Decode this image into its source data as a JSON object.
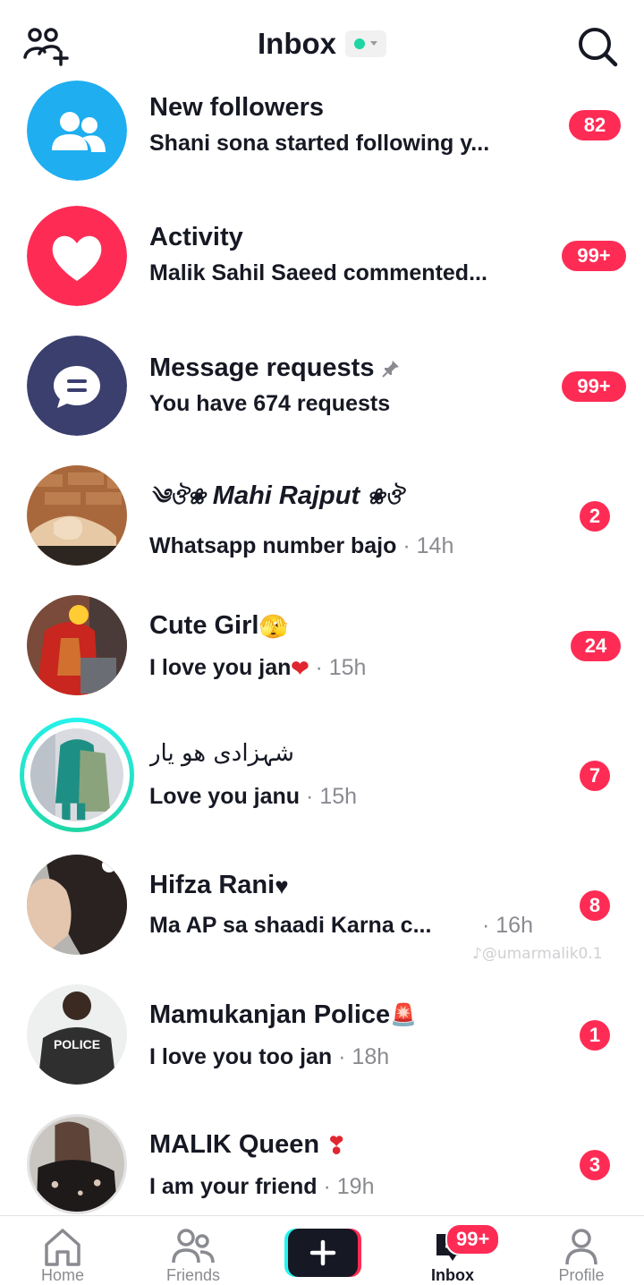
{
  "header": {
    "title": "Inbox",
    "status_color": "#20d5a4"
  },
  "rows": [
    {
      "name": "New followers",
      "sub": "Shani sona started following y...",
      "time": "",
      "badge": "82",
      "icon": "people-icon",
      "color": "#1faef0"
    },
    {
      "name": "Activity",
      "sub": "Malik Sahil Saeed commented...",
      "time": "",
      "badge": "99+",
      "icon": "heart-icon",
      "color": "#fe2c55"
    },
    {
      "name": "Message requests",
      "sub": "You have 674 requests",
      "time": "",
      "badge": "99+",
      "icon": "chat-bubble-icon",
      "color": "#3a3f6e"
    },
    {
      "name": "Mahi Rajput",
      "sub": "Whatsapp number bajo",
      "time": "· 14h",
      "badge": "2"
    },
    {
      "name": "Cute Girl",
      "sub": "I love you jan",
      "time": "· 15h",
      "badge": "24"
    },
    {
      "name": "شہزادی ھو یار",
      "sub": "Love you janu",
      "time": "· 15h",
      "badge": "7"
    },
    {
      "name": "Hifza Rani",
      "sub": "Ma AP sa shaadi Karna c...",
      "time": "· 16h",
      "badge": "8"
    },
    {
      "name": "Mamukanjan Police",
      "sub": "I love you too jan",
      "time": "· 18h",
      "badge": "1"
    },
    {
      "name": "MALIK Queen",
      "sub": "I am your friend",
      "time": "· 19h",
      "badge": "3"
    }
  ],
  "decor": {
    "mahi_left": "༄ঔ❀",
    "mahi_right": "❀ঔ",
    "avatar_badge_police": "POLICE"
  },
  "watermark": "♪@umarmalik0.1",
  "bottom_nav": {
    "home": "Home",
    "friends": "Friends",
    "inbox": "Inbox",
    "inbox_badge": "99+",
    "profile": "Profile"
  },
  "colors": {
    "accent": "#fe2c55",
    "cyan": "#25f4ee",
    "text": "#161823",
    "secondary": "#8a8b91"
  }
}
